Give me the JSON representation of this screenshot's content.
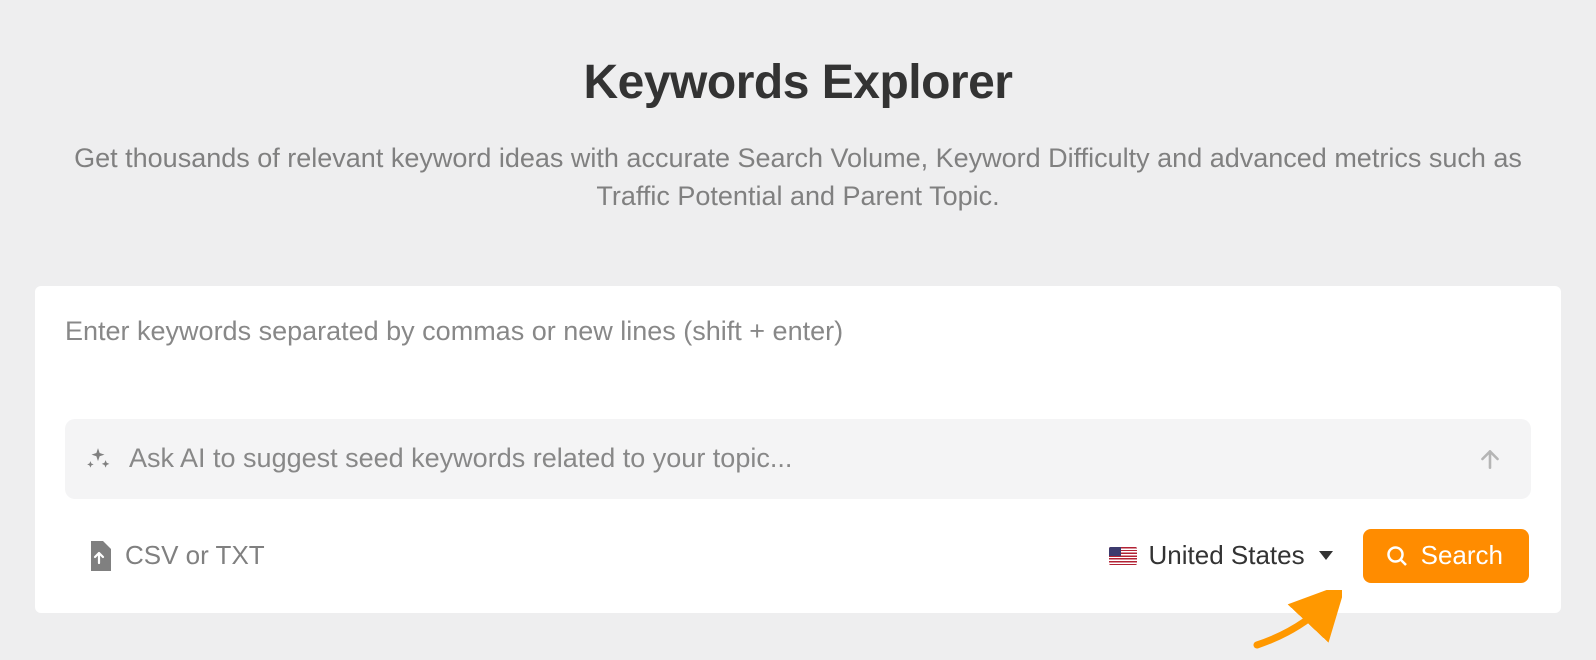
{
  "header": {
    "title": "Keywords Explorer",
    "subtitle": "Get thousands of relevant keyword ideas with accurate Search Volume, Keyword Difficulty and advanced metrics such as Traffic Potential and Parent Topic."
  },
  "card": {
    "keywords_placeholder": "Enter keywords separated by commas or new lines (shift + enter)",
    "ai_placeholder": "Ask AI to suggest seed keywords related to your topic...",
    "upload_label": "CSV or TXT",
    "country": {
      "name": "United States",
      "flag_code": "us"
    },
    "search_button_label": "Search"
  },
  "colors": {
    "accent": "#ff8c00",
    "page_bg": "#eeeeef",
    "text_muted": "#808080"
  },
  "icons": {
    "sparkle": "sparkle-icon",
    "send": "arrow-up-icon",
    "file_upload": "file-upload-icon",
    "search": "search-icon",
    "dropdown": "chevron-down-icon",
    "flag": "flag-us-icon"
  }
}
